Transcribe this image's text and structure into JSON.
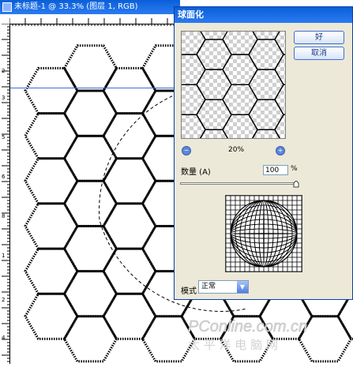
{
  "document": {
    "title": "未标题-1 @ 33.3% (图层 1, RGB)"
  },
  "dialog": {
    "title": "球面化",
    "ok_label": "好",
    "cancel_label": "取消",
    "zoom": {
      "value_label": "20%",
      "minus_symbol": "−",
      "plus_symbol": "+"
    },
    "amount": {
      "label": "数量 (A)",
      "value": "100",
      "unit": "%",
      "level_percent": 100
    },
    "mode": {
      "label": "模式",
      "selected": "正常"
    }
  },
  "watermark": {
    "line1": "PConline.com.cn",
    "line2": "太 平 洋 电 脑 网"
  },
  "colors": {
    "titlebar": "#0a5fd8",
    "dialog_bg": "#ece9d8",
    "button_text": "#1a3c8c",
    "guide": "#3a6cd8"
  }
}
